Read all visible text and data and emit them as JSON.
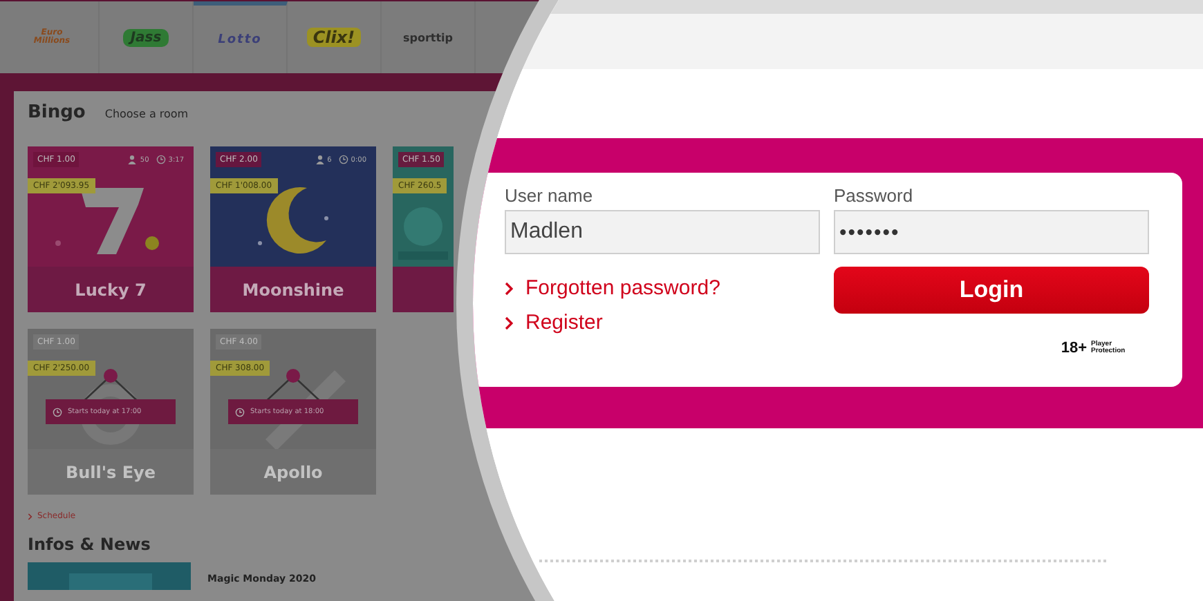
{
  "top_nav": {
    "logos": [
      {
        "label": "Euro Millions",
        "color": "#8a4a1c"
      },
      {
        "label": "Jass",
        "color": "#2f7a34",
        "kind": "badge"
      },
      {
        "label": "Lotto",
        "color": "#3b3f78"
      },
      {
        "label": "Clix!",
        "color": "#9c9222",
        "kind": "badge"
      },
      {
        "label": "sporttip",
        "color": "#2e2e2e"
      }
    ]
  },
  "bingo": {
    "title": "Bingo",
    "subtitle": "Choose a room",
    "rooms": [
      {
        "kind": "seven",
        "color": "#7a1a48",
        "scheduled": false,
        "price": "CHF 1.00",
        "jackpot": "CHF 2'093.95",
        "players": "50",
        "time": "3:17",
        "name": "Lucky 7"
      },
      {
        "kind": "moon",
        "color": "#23305a",
        "scheduled": false,
        "price": "CHF 2.00",
        "jackpot": "CHF 1'008.00",
        "players": "6",
        "time": "0:00",
        "name": "Moonshine"
      },
      {
        "kind": "teal",
        "color": "#1f5a55",
        "scheduled": false,
        "price": "CHF 1.50",
        "jackpot": "CHF 260.5"
      },
      {
        "kind": "target",
        "color": "#6a6a6a",
        "scheduled": true,
        "price": "CHF 1.00",
        "jackpot": "CHF 2'250.00",
        "start": "Starts today at 17:00",
        "name": "Bull's Eye"
      },
      {
        "kind": "rocket",
        "color": "#6a6a6a",
        "scheduled": true,
        "price": "CHF 4.00",
        "jackpot": "CHF 308.00",
        "start": "Starts today at 18:00",
        "name": "Apollo"
      }
    ],
    "schedule_link": "Schedule"
  },
  "news": {
    "title": "Infos & News",
    "items": [
      {
        "title": "Magic Monday 2020"
      }
    ]
  },
  "login": {
    "username": {
      "label": "User name",
      "value": "Madlen"
    },
    "password": {
      "label": "Password",
      "value": "•••••••"
    },
    "links": [
      "Forgotten password?",
      "Register"
    ],
    "button": "Login",
    "age_badge": "18+",
    "age_note": "Player Protection"
  }
}
